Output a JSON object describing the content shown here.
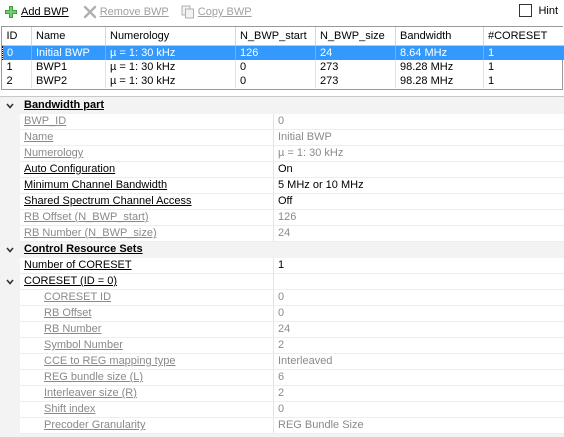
{
  "toolbar": {
    "add_label": "Add BWP",
    "remove_label": "Remove BWP",
    "copy_label": "Copy BWP",
    "hint_label": "Hint",
    "hint_checked": false
  },
  "table": {
    "columns": [
      "ID",
      "Name",
      "Numerology",
      "N_BWP_start",
      "N_BWP_size",
      "Bandwidth",
      "#CORESET"
    ],
    "rows": [
      [
        "0",
        "Initial BWP",
        "µ = 1: 30 kHz",
        "126",
        "24",
        "8.64 MHz",
        "1"
      ],
      [
        "1",
        "BWP1",
        "µ = 1: 30 kHz",
        "0",
        "273",
        "98.28 MHz",
        "1"
      ],
      [
        "2",
        "BWP2",
        "µ = 1: 30 kHz",
        "0",
        "273",
        "98.28 MHz",
        "1"
      ]
    ],
    "selected_row": 0,
    "selection_color": "#3399ff"
  },
  "props": {
    "bwp_category": "Bandwidth part",
    "bwp_id": {
      "name": "BWP_ID",
      "value": "0"
    },
    "name": {
      "name": "Name",
      "value": "Initial BWP"
    },
    "numerology": {
      "name": "Numerology",
      "value": "µ = 1: 30 kHz"
    },
    "auto_config": {
      "name": "Auto Configuration",
      "value": "On"
    },
    "min_ch_bw": {
      "name": "Minimum Channel Bandwidth",
      "value": "5 MHz or 10 MHz"
    },
    "shared_spectrum": {
      "name": "Shared Spectrum Channel Access",
      "value": "Off"
    },
    "rb_offset": {
      "name": "RB Offset (N_BWP_start)",
      "value": "126"
    },
    "rb_number": {
      "name": "RB Number (N_BWP_size)",
      "value": "24"
    },
    "crs_category": "Control Resource Sets",
    "num_coreset": {
      "name": "Number of CORESET",
      "value": "1"
    },
    "coreset0": {
      "name": "CORESET (ID = 0)",
      "value": ""
    },
    "coreset_id": {
      "name": "CORESET ID",
      "value": "0"
    },
    "cs_rb_offset": {
      "name": "RB Offset",
      "value": "0"
    },
    "cs_rb_number": {
      "name": "RB Number",
      "value": "24"
    },
    "symbol_number": {
      "name": "Symbol Number",
      "value": "2"
    },
    "cce_reg": {
      "name": "CCE to REG mapping type",
      "value": "Interleaved"
    },
    "reg_bundle": {
      "name": "REG bundle size (L)",
      "value": "6"
    },
    "interleaver": {
      "name": "Interleaver size (R)",
      "value": "2"
    },
    "shift_index": {
      "name": "Shift index",
      "value": "0"
    },
    "precoder": {
      "name": "Precoder Granularity",
      "value": "REG Bundle Size"
    }
  }
}
